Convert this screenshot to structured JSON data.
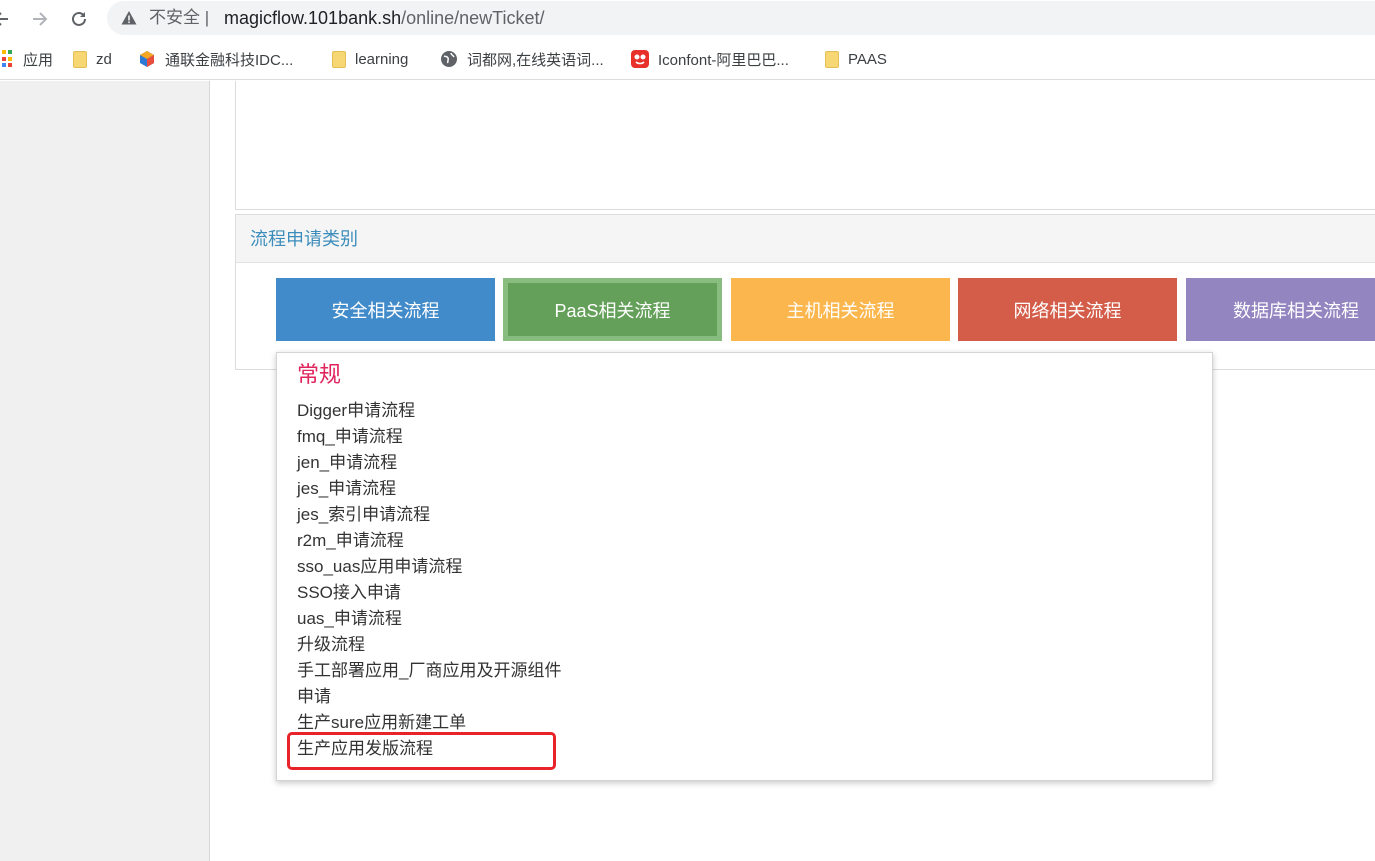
{
  "browser": {
    "insecure_label": "不安全",
    "url_host": "magicflow.101bank.sh",
    "url_path": "/online/newTicket/",
    "bookmarks": [
      {
        "label": "应用",
        "icon": "apps-grid-icon"
      },
      {
        "label": "zd",
        "icon": "folder-icon"
      },
      {
        "label": "通联金融科技IDC...",
        "icon": "cube-logo-icon"
      },
      {
        "label": "learning",
        "icon": "folder-icon"
      },
      {
        "label": "词都网,在线英语词...",
        "icon": "globe-icon"
      },
      {
        "label": "Iconfont-阿里巴巴...",
        "icon": "iconfont-logo-icon"
      },
      {
        "label": "PAAS",
        "icon": "folder-icon"
      }
    ]
  },
  "category_panel": {
    "heading": "流程申请类别",
    "buttons": [
      {
        "label": "安全相关流程",
        "color": "#428bca"
      },
      {
        "label": "PaaS相关流程",
        "color": "#65a05a",
        "active": true
      },
      {
        "label": "主机相关流程",
        "color": "#fbb74e"
      },
      {
        "label": "网络相关流程",
        "color": "#d45d4a"
      },
      {
        "label": "数据库相关流程",
        "color": "#9285c0"
      }
    ]
  },
  "dropdown": {
    "group_title": "常规",
    "items": [
      "Digger申请流程",
      "fmq_申请流程",
      "jen_申请流程",
      "jes_申请流程",
      "jes_索引申请流程",
      "r2m_申请流程",
      "sso_uas应用申请流程",
      "SSO接入申请",
      "uas_申请流程",
      "升级流程",
      "手工部署应用_厂商应用及开源组件",
      "申请",
      "生产sure应用新建工单",
      "生产应用发版流程"
    ],
    "highlighted_item": "生产应用发版流程",
    "highlight_color": "#e8232a"
  }
}
